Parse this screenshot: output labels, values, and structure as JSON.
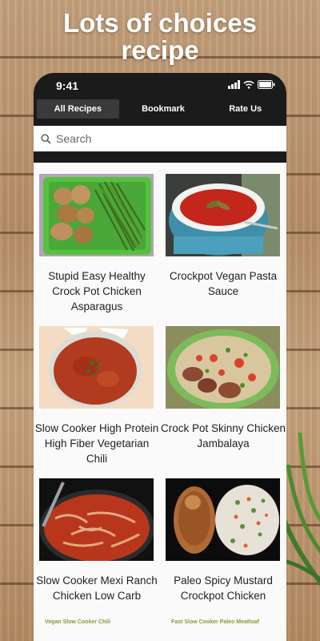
{
  "headline": {
    "line1": "Lots of choices",
    "line2": "recipe"
  },
  "status": {
    "time": "9:41"
  },
  "tabs": [
    {
      "label": "All Recipes",
      "active": true
    },
    {
      "label": "Bookmark",
      "active": false
    },
    {
      "label": "Rate Us",
      "active": false
    }
  ],
  "search": {
    "placeholder": "Search",
    "value": ""
  },
  "recipes": [
    {
      "title": "Stupid Easy Healthy Crock Pot Chicken Asparagus",
      "image": "chicken-asparagus"
    },
    {
      "title": "Crockpot Vegan Pasta Sauce",
      "image": "pasta-sauce-crockpot"
    },
    {
      "title": "Slow Cooker High Protein High Fiber Vegetarian Chili",
      "image": "vegetarian-chili"
    },
    {
      "title": "Crock Pot Skinny Chicken Jambalaya",
      "image": "jambalaya"
    },
    {
      "title": "Slow Cooker Mexi Ranch Chicken Low Carb",
      "image": "mexi-ranch-chicken"
    },
    {
      "title": "Paleo Spicy Mustard Crockpot Chicken",
      "image": "mustard-chicken"
    }
  ],
  "peek": {
    "left": "Vegan Slow Cooker Chili",
    "right": "Fast Slow Cooker Paleo Meatloaf"
  }
}
